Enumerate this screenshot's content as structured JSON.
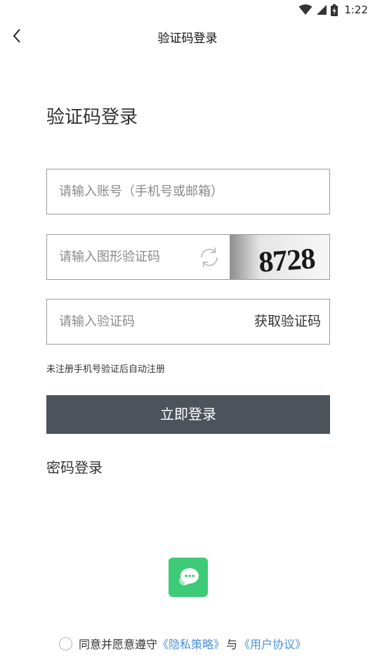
{
  "status_bar": {
    "time": "1:22"
  },
  "nav": {
    "title": "验证码登录"
  },
  "page_title": "验证码登录",
  "account_field": {
    "placeholder": "请输入账号（手机号或邮箱）"
  },
  "captcha_field": {
    "placeholder": "请输入图形验证码",
    "captcha_text": "8728"
  },
  "sms_field": {
    "placeholder": "请输入验证码",
    "get_code_label": "获取验证码"
  },
  "hint": "未注册手机号验证后自动注册",
  "login_button": "立即登录",
  "password_login": "密码登录",
  "agreement": {
    "prefix": "同意并愿意遵守",
    "privacy_link": "《隐私策略》",
    "and": "与",
    "terms_link": "《用户协议》"
  },
  "colors": {
    "login_button": "#4c535b",
    "wechat": "#3dcb78",
    "link": "#4a90d9"
  }
}
